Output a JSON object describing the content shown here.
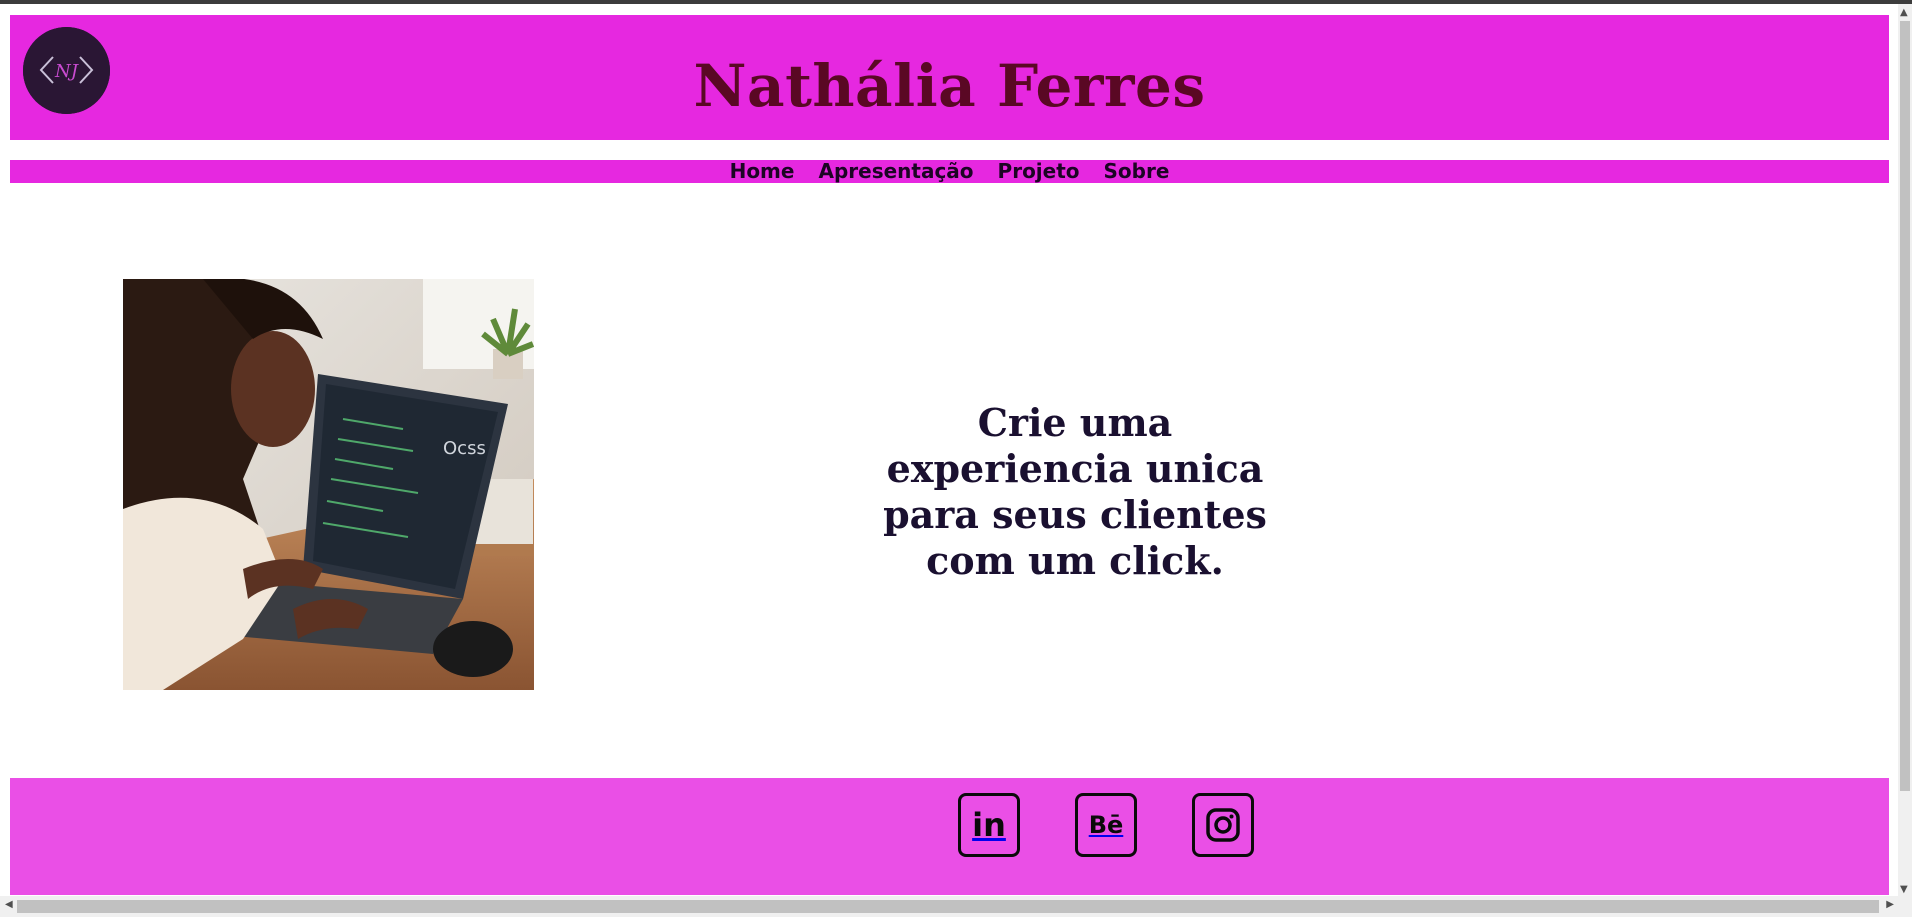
{
  "header": {
    "title": "Nathália Ferres",
    "logo_icon": "code-brackets-logo-icon"
  },
  "nav": {
    "items": [
      {
        "label": "Home"
      },
      {
        "label": "Apresentação"
      },
      {
        "label": "Projeto"
      },
      {
        "label": "Sobre"
      }
    ]
  },
  "hero": {
    "image_icon": "woman-coding-laptop-photo",
    "tagline": "Crie uma experiencia unica para seus clientes com um click."
  },
  "footer": {
    "social": [
      {
        "icon": "linkedin-icon",
        "label": "in"
      },
      {
        "icon": "behance-icon",
        "label": "Bē"
      },
      {
        "icon": "instagram-icon",
        "label": ""
      }
    ]
  },
  "colors": {
    "header_bg": "#e628e0",
    "footer_bg": "#ea4fe6",
    "title_color": "#5a0824",
    "text_dark": "#1a1030"
  }
}
